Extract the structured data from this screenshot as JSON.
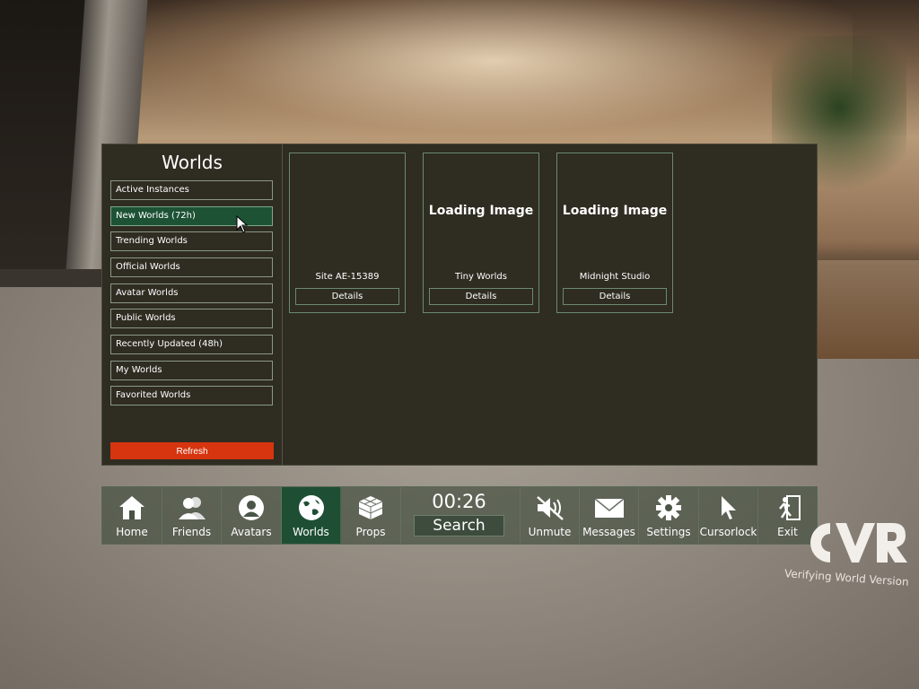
{
  "sidebar": {
    "title": "Worlds",
    "items": [
      {
        "label": "Active Instances",
        "active": false
      },
      {
        "label": "New Worlds (72h)",
        "active": true
      },
      {
        "label": "Trending Worlds",
        "active": false
      },
      {
        "label": "Official Worlds",
        "active": false
      },
      {
        "label": "Avatar Worlds",
        "active": false
      },
      {
        "label": "Public Worlds",
        "active": false
      },
      {
        "label": "Recently Updated (48h)",
        "active": false
      },
      {
        "label": "My Worlds",
        "active": false
      },
      {
        "label": "Favorited Worlds",
        "active": false
      }
    ],
    "refresh_label": "Refresh"
  },
  "worlds": [
    {
      "image_text": "",
      "name": "Site AE-15389",
      "details_label": "Details"
    },
    {
      "image_text": "Loading Image",
      "name": "Tiny Worlds",
      "details_label": "Details"
    },
    {
      "image_text": "Loading Image",
      "name": "Midnight Studio",
      "details_label": "Details"
    }
  ],
  "toolbar": {
    "items": [
      {
        "label": "Home",
        "icon": "home-icon"
      },
      {
        "label": "Friends",
        "icon": "friends-icon"
      },
      {
        "label": "Avatars",
        "icon": "avatar-icon"
      },
      {
        "label": "Worlds",
        "icon": "globe-icon",
        "active": true
      },
      {
        "label": "Props",
        "icon": "cube-icon"
      },
      {
        "label": "Unmute",
        "icon": "muted-speaker-icon"
      },
      {
        "label": "Messages",
        "icon": "envelope-icon"
      },
      {
        "label": "Settings",
        "icon": "gear-icon"
      },
      {
        "label": "Cursorlock",
        "icon": "cursor-icon"
      },
      {
        "label": "Exit",
        "icon": "exit-icon"
      }
    ],
    "timer": "00:26",
    "search_label": "Search"
  },
  "overlay": {
    "logo_text": "CVR",
    "status_text": "Verifying World Version"
  },
  "colors": {
    "panel_bg": "#2f2c22",
    "active_green": "#1d5235",
    "refresh_red": "#d6350f"
  }
}
